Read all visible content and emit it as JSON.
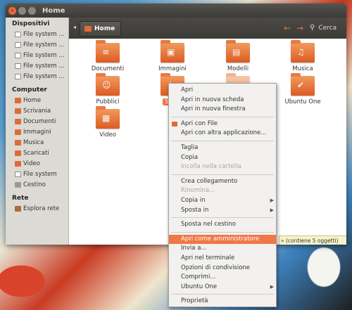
{
  "window": {
    "title": "Home",
    "close_glyph": "×",
    "breadcrumb": "Home",
    "search_label": "Cerca",
    "back_icon": "go-back-arrow-icon",
    "forward_icon": "go-forward-arrow-icon"
  },
  "sidebar": {
    "devices_header": "Dispositivi",
    "devices": [
      "File system ...",
      "File system ...",
      "File system ...",
      "File system ...",
      "File system ..."
    ],
    "computer_header": "Computer",
    "computer": [
      "Home",
      "Scrivania",
      "Documenti",
      "Immagini",
      "Musica",
      "Scaricati",
      "Video",
      "File system",
      "Cestino"
    ],
    "network_header": "Rete",
    "network": [
      "Esplora rete"
    ]
  },
  "files": [
    {
      "label": "Documenti",
      "icon": "documents-folder-icon"
    },
    {
      "label": "Immagini",
      "icon": "pictures-folder-icon"
    },
    {
      "label": "Modelli",
      "icon": "templates-folder-icon"
    },
    {
      "label": "Musica",
      "icon": "music-folder-icon"
    },
    {
      "label": "Pubblici",
      "icon": "public-folder-icon"
    },
    {
      "label": "Scari",
      "icon": "downloads-folder-icon"
    },
    {
      "label": "Scrivania",
      "icon": "desktop-folder-icon"
    },
    {
      "label": "Ubuntu One",
      "icon": "ubuntu-one-folder-icon"
    },
    {
      "label": "Video",
      "icon": "videos-folder-icon"
    }
  ],
  "status": "» (contiene 5 oggetti)",
  "context_menu": {
    "groups": [
      [
        {
          "label": "Apri"
        },
        {
          "label": "Apri in nuova scheda"
        },
        {
          "label": "Apri in nuova finestra"
        }
      ],
      [
        {
          "label": "Apri con File",
          "icon": "folder-icon"
        },
        {
          "label": "Apri con altra applicazione..."
        }
      ],
      [
        {
          "label": "Taglia"
        },
        {
          "label": "Copia"
        },
        {
          "label": "Incolla nella cartella",
          "disabled": true
        }
      ],
      [
        {
          "label": "Crea collegamento"
        },
        {
          "label": "Rinomina...",
          "disabled": true
        },
        {
          "label": "Copia in",
          "submenu": true
        },
        {
          "label": "Sposta in",
          "submenu": true
        }
      ],
      [
        {
          "label": "Sposta nel cestino"
        }
      ],
      [
        {
          "label": "Apri come amministratore",
          "highlighted": true
        },
        {
          "label": "Invia a..."
        },
        {
          "label": "Apri nel terminale"
        },
        {
          "label": "Opzioni di condivisione"
        },
        {
          "label": "Comprimi..."
        },
        {
          "label": "Ubuntu One",
          "submenu": true
        }
      ],
      [
        {
          "label": "Proprietà"
        }
      ]
    ],
    "submenu_glyph": "▶"
  },
  "colors": {
    "accent": "#f07746",
    "folder": "#e06b34",
    "titlebar": "#3c3b37"
  }
}
